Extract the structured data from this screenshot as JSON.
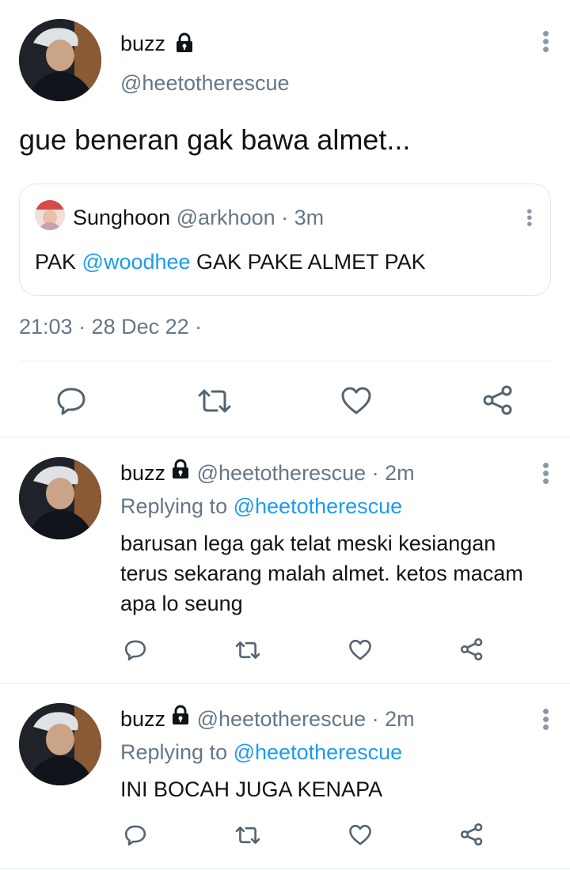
{
  "main_tweet": {
    "user": {
      "name": "buzz",
      "handle": "@heetotherescue"
    },
    "text": "gue beneran gak bawa almet...",
    "quote": {
      "name": "Sunghoon",
      "handle": "@arkhoon",
      "time": "3m",
      "text_prefix": "PAK ",
      "mention": "@woodhee",
      "text_suffix": " GAK PAKE ALMET PAK"
    },
    "timestamp": "21:03 · 28 Dec 22 ·"
  },
  "replies": [
    {
      "name": "buzz",
      "handle": "@heetotherescue",
      "time": "2m",
      "replying_label": "Replying to",
      "replying_to": "@heetotherescue",
      "lines": [
        "barusan lega gak telat meski kesiangan",
        "terus sekarang malah almet. ketos macam",
        "apa lo seung"
      ]
    },
    {
      "name": "buzz",
      "handle": "@heetotherescue",
      "time": "2m",
      "replying_label": "Replying to",
      "replying_to": "@heetotherescue",
      "lines": [
        "INI BOCAH JUGA KENAPA"
      ]
    }
  ],
  "icons": {
    "reply": "speech-bubble-icon",
    "retweet": "retweet-icon",
    "like": "heart-icon",
    "share": "share-icon",
    "more": "vertical-dots-icon",
    "lock": "lock-icon"
  },
  "colors": {
    "link": "#1d9bf0",
    "secondary_text": "#657786",
    "divider": "#e6ecf0"
  }
}
